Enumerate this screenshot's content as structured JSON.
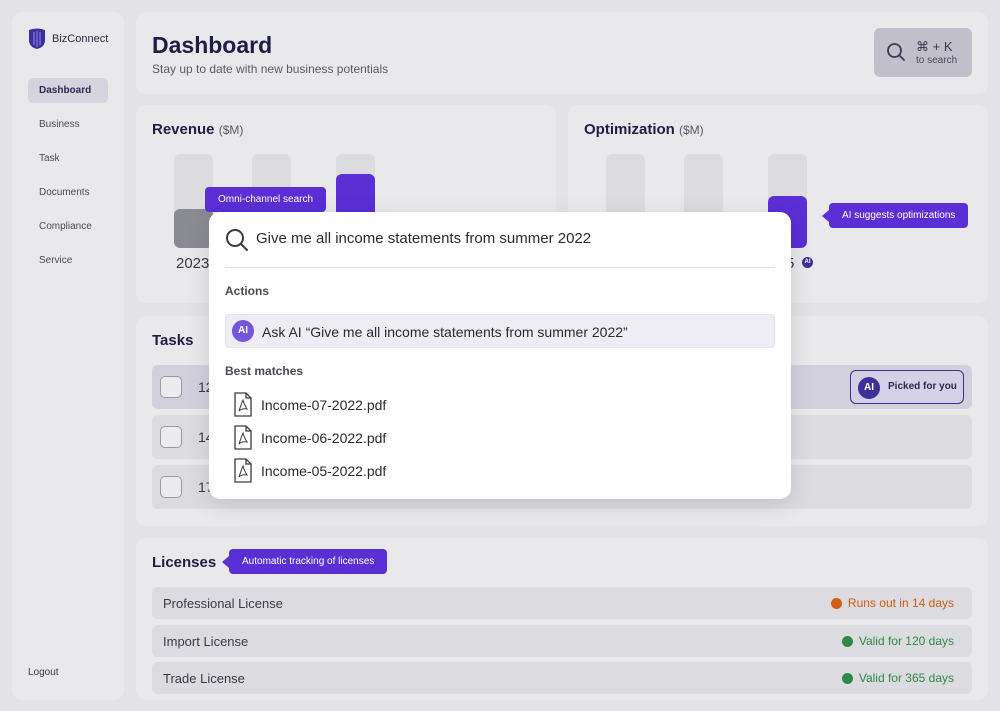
{
  "app": {
    "name": "BizConnect",
    "brand_color": "#3d2f9c",
    "accent_color": "#5a2fd6"
  },
  "sidebar": {
    "items": [
      {
        "label": "Dashboard",
        "active": true
      },
      {
        "label": "Business"
      },
      {
        "label": "Task"
      },
      {
        "label": "Documents"
      },
      {
        "label": "Compliance"
      },
      {
        "label": "Service"
      }
    ],
    "logout_label": "Logout"
  },
  "header": {
    "title": "Dashboard",
    "subtitle": "Stay up to date with new business potentials",
    "search_shortcut": "⌘ + K",
    "search_hint": "to search"
  },
  "revenue": {
    "title": "Revenue",
    "unit": "($M)",
    "visible_label": "2023",
    "bar_levels": [
      0.42,
      0.63,
      0.79
    ]
  },
  "optimization": {
    "title": "Optimization",
    "unit": "($M)",
    "visible_label": "5",
    "bar_levels": [
      0.0,
      0.0,
      0.55
    ],
    "ai_badge": "AI"
  },
  "tooltips": {
    "search": "Omni-channel search",
    "optimizations": "AI suggests optimizations",
    "licenses": "Automatic tracking of licenses"
  },
  "tasks": {
    "title": "Tasks",
    "rows": [
      {
        "text": "12"
      },
      {
        "text": "14"
      },
      {
        "text": "17"
      }
    ],
    "picked_label": "Picked for you",
    "ai_badge": "AI"
  },
  "licenses": {
    "title": "Licenses",
    "rows": [
      {
        "name": "Professional License",
        "status": "Runs out in 14 days",
        "color": "#d35b12"
      },
      {
        "name": "Import License",
        "status": "Valid for 120 days",
        "color": "#2f8a4a"
      },
      {
        "name": "Trade License",
        "status": "Valid for 365 days",
        "color": "#2f8a4a"
      }
    ]
  },
  "search_modal": {
    "query": "Give me all income statements from summer 2022",
    "actions_label": "Actions",
    "ai_action": "Ask AI “Give me all income statements from summer 2022”",
    "ai_badge": "AI",
    "matches_label": "Best matches",
    "files": [
      "Income-07-2022.pdf",
      "Income-06-2022.pdf",
      "Income-05-2022.pdf"
    ]
  }
}
